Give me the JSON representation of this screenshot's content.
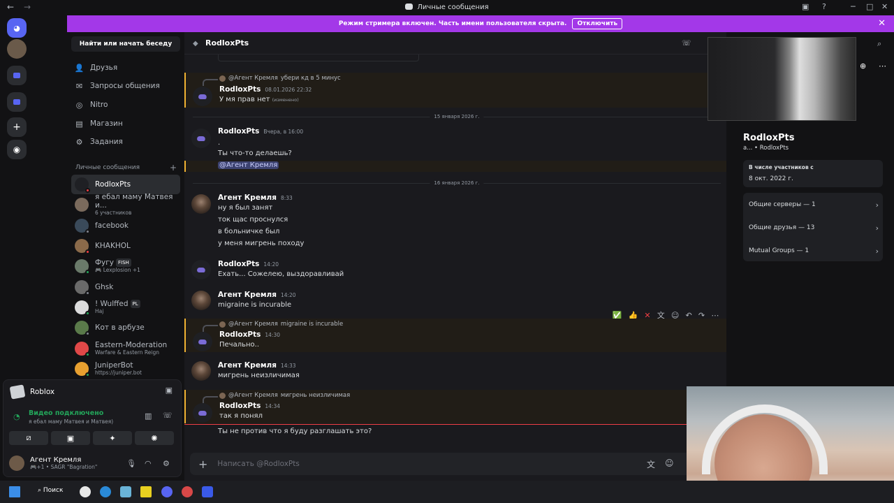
{
  "window": {
    "title": "Личные сообщения",
    "back": "←",
    "forward": "→"
  },
  "streamer_banner": {
    "text": "Режим стримера включен. Часть имени пользователя скрыта.",
    "button": "Отключить",
    "close": "✕"
  },
  "dm_sidebar": {
    "search": "Найти или начать беседу",
    "nav": [
      {
        "label": "Друзья",
        "icon": "friends-icon"
      },
      {
        "label": "Запросы общения",
        "icon": "message-requests-icon"
      },
      {
        "label": "Nitro",
        "icon": "nitro-icon"
      },
      {
        "label": "Магазин",
        "icon": "shop-icon"
      },
      {
        "label": "Задания",
        "icon": "quests-icon"
      }
    ],
    "section_title": "Личные сообщения",
    "section_add": "+",
    "dms": [
      {
        "name": "RodloxPts",
        "sub": "",
        "color": "#1f2024",
        "status": "#f23f43"
      },
      {
        "name": "я ебал маму Матвея и...",
        "sub": "6 участников",
        "color": "#7a6a5c",
        "status": ""
      },
      {
        "name": "facebook",
        "sub": "",
        "color": "#3a4a5a",
        "status": "#80848e"
      },
      {
        "name": "KHAKHOL",
        "sub": "",
        "color": "#8a6a4a",
        "status": "#f23f43"
      },
      {
        "name": "Фугу",
        "sub": "🎮 Lexplosion +1",
        "color": "#6a7a6a",
        "status": "#23a55a",
        "tag": "FISH"
      },
      {
        "name": "Ghsk",
        "sub": "",
        "color": "#6a6a6a",
        "status": "#80848e"
      },
      {
        "name": "! Wulffed",
        "sub": "Haj",
        "color": "#dcdcdc",
        "status": "#23a55a",
        "tag": "PL"
      },
      {
        "name": "Кот в арбузе",
        "sub": "",
        "color": "#5a7a4a",
        "status": "#80848e"
      },
      {
        "name": "Eastern-Moderation",
        "sub": "Warfare & Eastern Reign",
        "color": "#e04848",
        "status": "#23a55a"
      },
      {
        "name": "JuniperBot",
        "sub": "https://juniper.bot",
        "color": "#e8a030",
        "status": "#23a55a"
      }
    ]
  },
  "voice_panel": {
    "game": "Roblox",
    "status": "Видео подключено",
    "channel": "я ебал маму Матвея и Матвея)",
    "user_name": "Агент Кремля",
    "user_sub": "🎮+1 • SAGR \"Bagration\""
  },
  "chat": {
    "recipient": "RodloxPts",
    "placeholder": "Написать @RodloxPts",
    "messages": {
      "m1": {
        "reply_name": "@Агент Кремля",
        "reply_text": "убери кд в 5 минус",
        "author": "RodloxPts",
        "time": "08.01.2026 22:32",
        "line1": "У мя прав нет",
        "edited": "(изменено)"
      },
      "div1": "15 января 2026 г.",
      "m2": {
        "author": "RodloxPts",
        "time": "Вчера, в 16:00",
        "line1": ".",
        "line2": "Ты что-то делаешь?",
        "line3": "@Агент Кремля"
      },
      "div2": "16 января 2026 г.",
      "m3": {
        "author": "Агент Кремля",
        "time": "8:33",
        "lines": [
          "ну я был занят",
          "ток щас проснулся",
          "в больничке был",
          "у меня мигрень походу"
        ]
      },
      "m4": {
        "author": "RodloxPts",
        "time": "14:20",
        "line1": "Ехать... Сожелею, выздоравливай"
      },
      "m5": {
        "author": "Агент Кремля",
        "time": "14:20",
        "line1": "migraine is incurable"
      },
      "m6": {
        "reply_name": "@Агент Кремля",
        "reply_text": "migraine is incurable",
        "author": "RodloxPts",
        "time": "14:30",
        "line1": "Печально.."
      },
      "m7": {
        "author": "Агент Кремля",
        "time": "14:33",
        "line1": "мигрень неизличимая"
      },
      "m8": {
        "reply_name": "@Агент Кремля",
        "reply_text": "мигрень неизличимая",
        "author": "RodloxPts",
        "time": "14:34",
        "line1": "так я понял"
      },
      "m9": {
        "line1": "Ты не против что я буду разглашать это?"
      }
    }
  },
  "profile": {
    "name": "RodloxPts",
    "sub": "a... • RodloxPts",
    "member_since_label": "В числе участников с",
    "member_since": "8 окт. 2022 г.",
    "rows": [
      "Общие серверы — 1",
      "Общие друзья — 13",
      "Mutual Groups — 1"
    ]
  },
  "taskbar": {
    "search": "Поиск"
  },
  "colors": {
    "accent": "#5865f2",
    "banner": "#a338e8",
    "mention_highlight": "#f0b232",
    "online": "#23a55a",
    "dnd": "#f23f43"
  }
}
